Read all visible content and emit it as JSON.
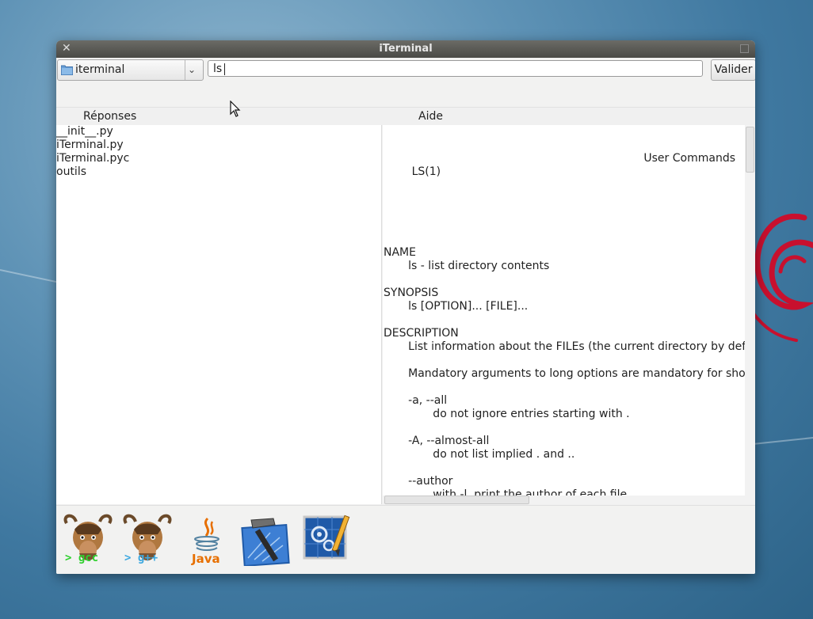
{
  "window": {
    "title": "iTerminal"
  },
  "toolbar": {
    "directory_selected": "iterminal",
    "command_value": "ls",
    "submit_label": "Valider"
  },
  "panes": {
    "responses_header": "Réponses",
    "help_header": "Aide"
  },
  "responses": {
    "items": [
      "__init__.py",
      "iTerminal.py",
      "iTerminal.pyc",
      "outils"
    ]
  },
  "help": {
    "head_left": "LS(1)",
    "head_right": "User Commands",
    "body": "\n\n\n\nNAME\n       ls - list directory contents\n\nSYNOPSIS\n       ls [OPTION]... [FILE]...\n\nDESCRIPTION\n       List information about the FILEs (the current directory by default).\n\n       Mandatory arguments to long options are mandatory for short opt\n\n       -a, --all\n              do not ignore entries starting with .\n\n       -A, --almost-all\n              do not list implied . and ..\n\n       --author\n              with -l, print the author of each file\n\n       -b, --escape\n              print octal escapes for nongraphic characters\n\n       --block-size=SIZE"
  },
  "launcher": {
    "gcc_label": "> gcc",
    "gpp_label": "> g++",
    "java_label": "Java"
  },
  "colors": {
    "titlebar": "#4f4f4b",
    "window_bg": "#f0f0f0",
    "desktop": "#4a82aa",
    "debian_red": "#c8102e"
  }
}
